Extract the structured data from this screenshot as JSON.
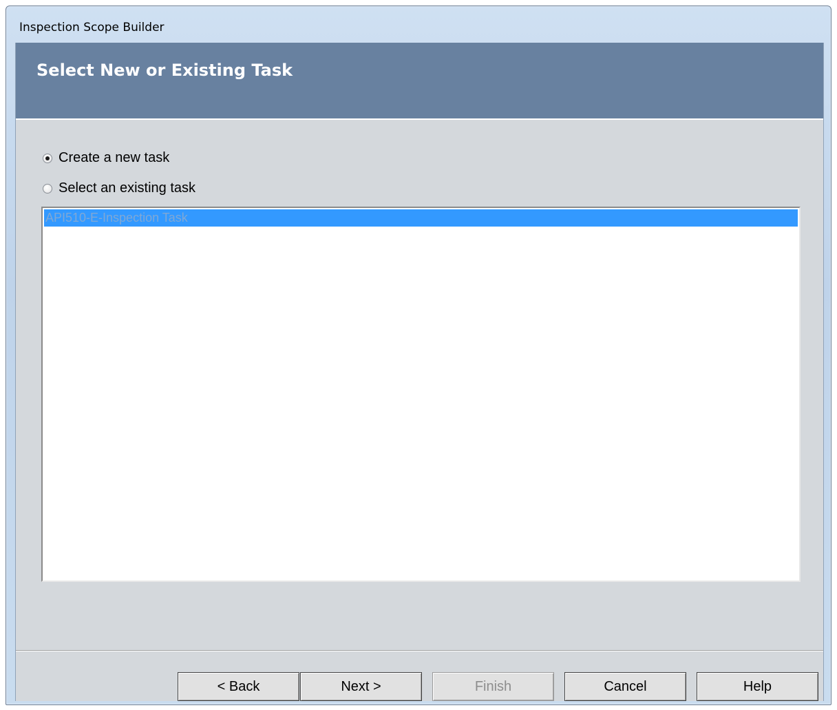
{
  "window": {
    "title": "Inspection Scope Builder"
  },
  "header": {
    "title": "Select New or Existing Task"
  },
  "options": {
    "create_new": {
      "label": "Create a new task",
      "selected": true
    },
    "select_existing": {
      "label": "Select an existing task",
      "selected": false
    }
  },
  "task_list": {
    "items": [
      {
        "label": "API510-E-Inspection Task",
        "selected": true
      }
    ]
  },
  "buttons": {
    "back": "< Back",
    "next": "Next >",
    "finish": "Finish",
    "cancel": "Cancel",
    "help": "Help"
  },
  "colors": {
    "header_band": "#6881a0",
    "selection": "#3399ff",
    "dialog_bg": "#d4d8dc"
  }
}
